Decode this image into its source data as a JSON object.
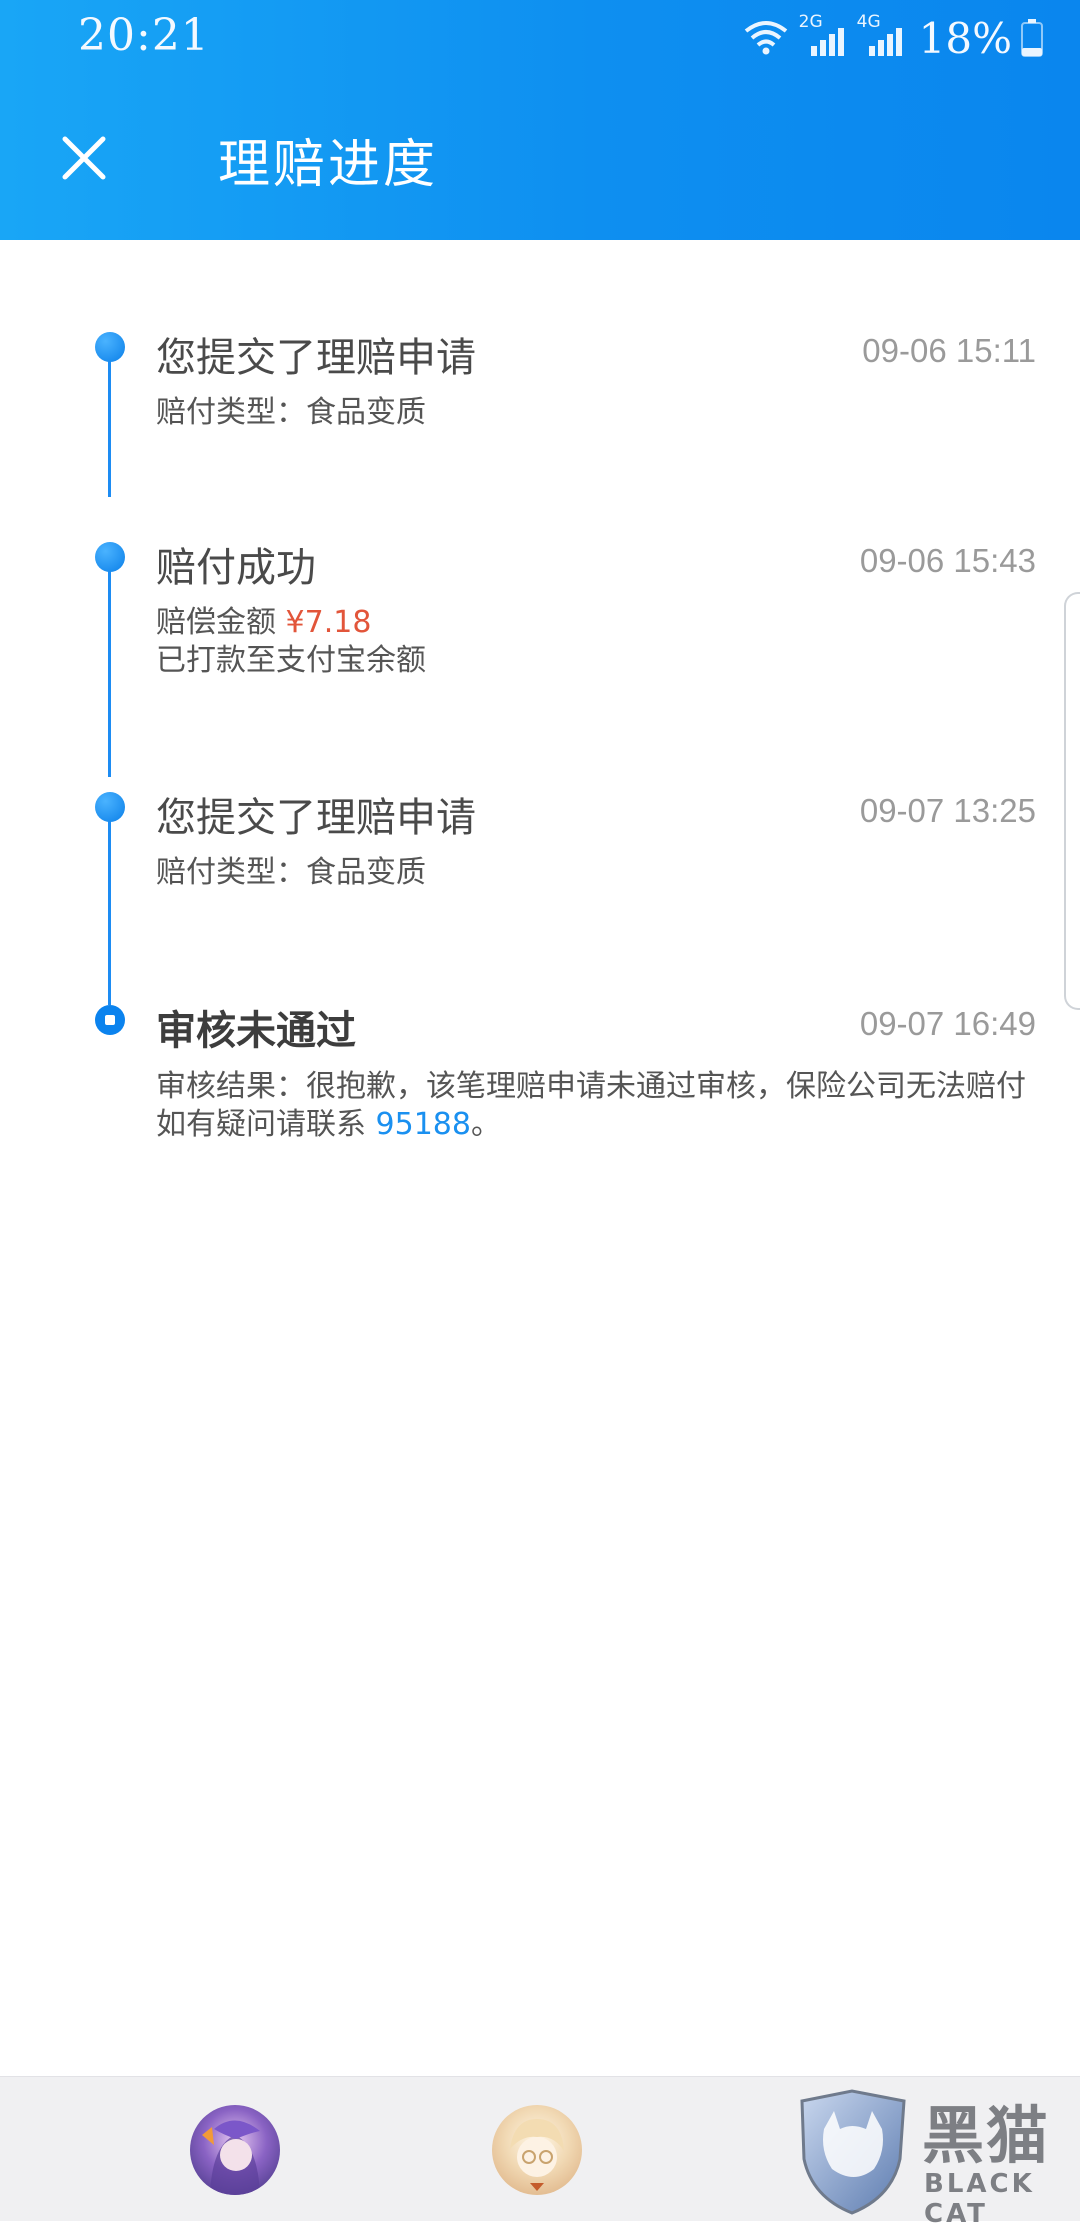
{
  "status_bar": {
    "time": "20:21",
    "network_labels": [
      "2G",
      "4G"
    ],
    "battery_percent": "18%",
    "icons": [
      "wifi-icon",
      "signal-2g-icon",
      "signal-4g-icon",
      "battery-icon"
    ]
  },
  "header": {
    "close_icon": "close-icon",
    "title": "理赔进度"
  },
  "timeline": {
    "events": [
      {
        "title": "您提交了理赔申请",
        "time": "09-06 15:11",
        "detail": "赔付类型：食品变质"
      },
      {
        "title": "赔付成功",
        "time": "09-06 15:43",
        "amount_label": "赔偿金额 ",
        "amount": "¥7.18",
        "detail_line2": "已打款至支付宝余额"
      },
      {
        "title": "您提交了理赔申请",
        "time": "09-07 13:25",
        "detail": "赔付类型：食品变质"
      },
      {
        "title": "审核未通过",
        "time": "09-07 16:49",
        "detail": "审核结果：很抱歉，该笔理赔申请未通过审核，保险公司无法赔付",
        "contact_prefix": "如有疑问请联系 ",
        "contact_phone": "95188",
        "contact_suffix": "。"
      }
    ],
    "colors": {
      "line": "#1d8cf3",
      "amount": "#e2553a",
      "link": "#1a90f0"
    }
  },
  "bottom_bar": {
    "avatars": [
      "avatar-purple-hair",
      "avatar-blonde-glasses"
    ],
    "watermark_cn": "黑猫",
    "watermark_en": "BLACK CAT"
  },
  "theme": {
    "header_gradient_start": "#19a6f6",
    "header_gradient_end": "#0a86ee"
  }
}
